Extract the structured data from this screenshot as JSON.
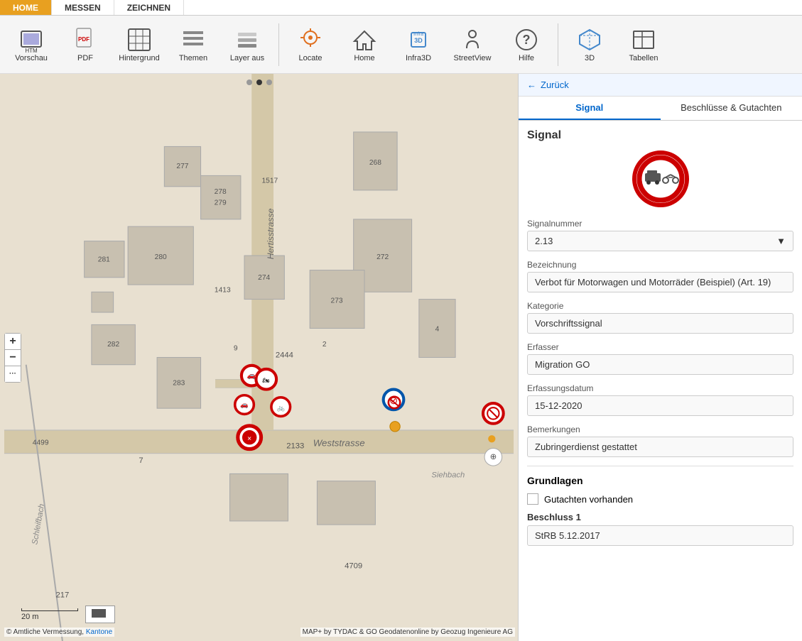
{
  "nav": {
    "items": [
      {
        "label": "HOME",
        "active": true
      },
      {
        "label": "MESSEN",
        "active": false
      },
      {
        "label": "ZEICHNEN",
        "active": false
      }
    ]
  },
  "toolbar": {
    "buttons": [
      {
        "id": "vorschau",
        "label": "Vorschau",
        "icon": "🖼"
      },
      {
        "id": "pdf",
        "label": "PDF",
        "icon": "📄"
      },
      {
        "id": "hintergrund",
        "label": "Hintergrund",
        "icon": "🗺"
      },
      {
        "id": "themen",
        "label": "Themen",
        "icon": "📋"
      },
      {
        "id": "layer-aus",
        "label": "Layer aus",
        "icon": "📑"
      },
      {
        "id": "locate",
        "label": "Locate",
        "icon": "📍"
      },
      {
        "id": "home",
        "label": "Home",
        "icon": "🏠"
      },
      {
        "id": "infra3d",
        "label": "Infra3D",
        "icon": "🔷"
      },
      {
        "id": "streetview",
        "label": "StreetView",
        "icon": "👤"
      },
      {
        "id": "hilfe",
        "label": "Hilfe",
        "icon": "❓"
      },
      {
        "id": "3d",
        "label": "3D",
        "icon": "🎲"
      },
      {
        "id": "tabellen",
        "label": "Tabellen",
        "icon": "📊"
      }
    ]
  },
  "locate_label": "LoCate",
  "map": {
    "scale_text": "20 m",
    "copyright": "© Amtliche Vermessung,",
    "kantone_link": "Kantone",
    "credit": "MAP+ by TYDAC & GO Geodatenonline by Geozug Ingenieure AG"
  },
  "panel": {
    "back_label": "Zurück",
    "tabs": [
      {
        "label": "Signal",
        "active": true
      },
      {
        "label": "Beschlüsse & Gutachten",
        "active": false
      }
    ],
    "section_title": "Signal",
    "fields": [
      {
        "label": "Signalnummer",
        "value": "2.13",
        "has_arrow": true
      },
      {
        "label": "Bezeichnung",
        "value": "Verbot für Motorwagen und Motorräder (Beispiel) (Art. 19)"
      },
      {
        "label": "Kategorie",
        "value": "Vorschriftssignal"
      },
      {
        "label": "Erfasser",
        "value": "Migration GO"
      },
      {
        "label": "Erfassungsdatum",
        "value": "15-12-2020"
      },
      {
        "label": "Bemerkungen",
        "value": "Zubringerdienst gestattet"
      }
    ],
    "grundlagen": {
      "title": "Grundlagen",
      "checkbox_label": "Gutachten vorhanden",
      "beschluss_label": "Beschluss 1",
      "beschluss_value": "StRB 5.12.2017"
    }
  }
}
